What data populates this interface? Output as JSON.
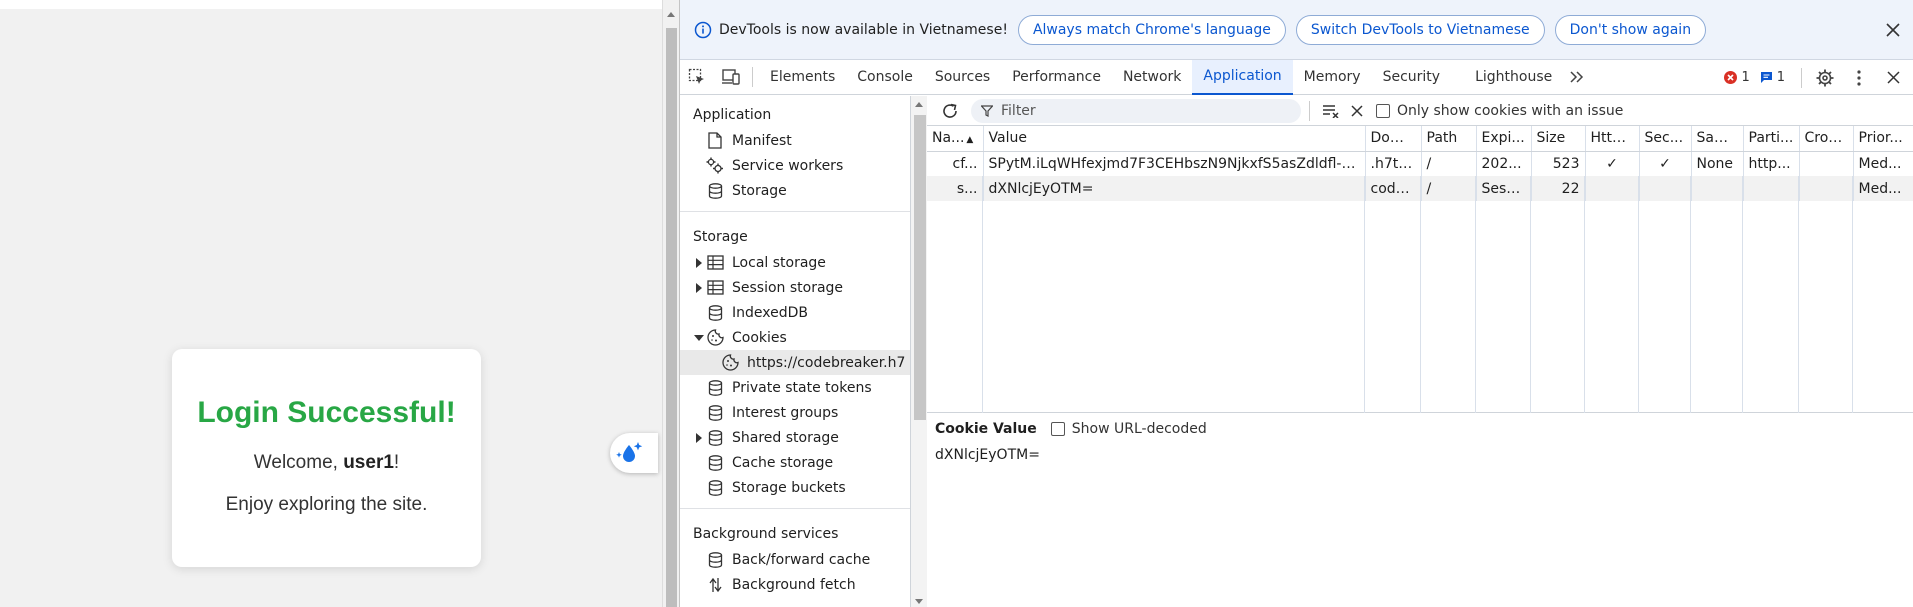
{
  "page": {
    "login_title": "Login Successful!",
    "welcome_prefix": "Welcome, ",
    "welcome_user": "user1",
    "welcome_suffix": "!",
    "enjoy_text": "Enjoy exploring the site.",
    "title_color": "#28a745"
  },
  "infobar": {
    "message": "DevTools is now available in Vietnamese!",
    "btn_match": "Always match Chrome's language",
    "btn_switch": "Switch DevTools to Vietnamese",
    "btn_dont_show": "Don't show again"
  },
  "tabs": {
    "elements": "Elements",
    "console": "Console",
    "sources": "Sources",
    "performance": "Performance",
    "network": "Network",
    "application": "Application",
    "memory": "Memory",
    "security": "Security",
    "lighthouse": "Lighthouse",
    "error_count": "1",
    "message_count": "1"
  },
  "sidebar": {
    "application_header": "Application",
    "manifest": "Manifest",
    "service_workers": "Service workers",
    "storage_item": "Storage",
    "storage_header": "Storage",
    "local_storage": "Local storage",
    "session_storage": "Session storage",
    "indexeddb": "IndexedDB",
    "cookies": "Cookies",
    "cookie_origin": "https://codebreaker.h7",
    "private_state_tokens": "Private state tokens",
    "interest_groups": "Interest groups",
    "shared_storage": "Shared storage",
    "cache_storage": "Cache storage",
    "storage_buckets": "Storage buckets",
    "background_header": "Background services",
    "bf_cache": "Back/forward cache",
    "background_fetch": "Background fetch"
  },
  "toolbar": {
    "filter_placeholder": "Filter",
    "only_issue_label": "Only show cookies with an issue"
  },
  "cookies_table": {
    "columns": [
      "Na...",
      "Value",
      "Dom...",
      "Path",
      "Expi...",
      "Size",
      "Http...",
      "Sec...",
      "Sam...",
      "Parti...",
      "Cros...",
      "Prior..."
    ],
    "rows": [
      [
        "cf...",
        "SPytM.iLqWHfexjmd7F3CEHbszN9NjkxfS5asZdldfl-17...",
        ".h7te...",
        "/",
        "202...",
        "523",
        "✓",
        "✓",
        "None",
        "http...",
        "",
        "Med..."
      ],
      [
        "s...",
        "dXNlcjEyOTM=",
        "code...",
        "/",
        "Sess...",
        "22",
        "",
        "",
        "",
        "",
        "",
        "Med..."
      ]
    ]
  },
  "cookie_value": {
    "title": "Cookie Value",
    "decoded_label": "Show URL-decoded",
    "value": "dXNlcjEyOTM="
  },
  "colors": {
    "accent": "#0b57d0",
    "error": "#d93025",
    "success": "#28a745"
  }
}
